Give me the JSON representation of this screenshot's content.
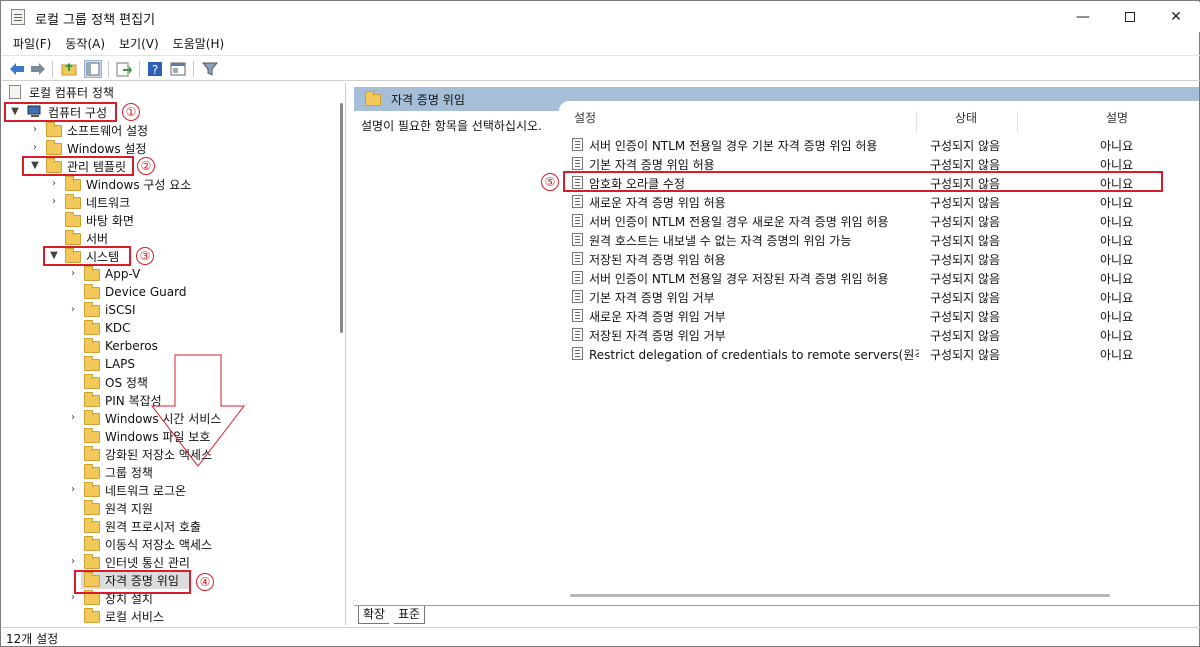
{
  "window": {
    "title": "로컬 그룹 정책 편집기",
    "minimize_icon": "minimize-icon",
    "maximize_icon": "maximize-icon",
    "close_icon": "close-icon"
  },
  "menu": [
    "파일(F)",
    "동작(A)",
    "보기(V)",
    "도움말(H)"
  ],
  "toolbar": [
    "back-arrow-icon",
    "forward-arrow-icon",
    "up-folder-icon",
    "show-hide-tree-icon",
    "export-list-icon",
    "help-icon",
    "properties-icon",
    "filter-icon"
  ],
  "tree": {
    "root": "로컬 컴퓨터 정책",
    "computer_config": "컴퓨터 구성",
    "software_settings": "소프트웨어 설정",
    "windows_settings": "Windows 설정",
    "admin_templates": "관리 템플릿",
    "admin_children": [
      "Windows 구성 요소",
      "네트워크",
      "바탕 화면",
      "서버"
    ],
    "system": "시스템",
    "system_children": [
      "App-V",
      "Device Guard",
      "iSCSI",
      "KDC",
      "Kerberos",
      "LAPS",
      "OS 정책",
      "PIN 복잡성",
      "Windows 시간 서비스",
      "Windows 파일 보호",
      "강화된 저장소 액세스",
      "그룹 정책",
      "네트워크 로그온",
      "원격 지원",
      "원격 프로시저 호출",
      "이동식 저장소 액세스",
      "인터넷 통신 관리",
      "자격 증명 위임",
      "장치 설치",
      "로컬 서비스"
    ]
  },
  "annotations": [
    "①",
    "②",
    "③",
    "④",
    "⑤"
  ],
  "right": {
    "header": "자격 증명 위임",
    "description": "설명이 필요한 항목을 선택하십시오.",
    "columns": [
      "설정",
      "상태",
      "설명"
    ],
    "rows": [
      {
        "setting": "서버 인증이 NTLM 전용일 경우 기본 자격 증명 위임 허용",
        "state": "구성되지 않음",
        "comment": "아니요"
      },
      {
        "setting": "기본 자격 증명 위임 허용",
        "state": "구성되지 않음",
        "comment": "아니요"
      },
      {
        "setting": "암호화 오라클 수정",
        "state": "구성되지 않음",
        "comment": "아니요"
      },
      {
        "setting": "새로운 자격 증명 위임 허용",
        "state": "구성되지 않음",
        "comment": "아니요"
      },
      {
        "setting": "서버 인증이 NTLM 전용일 경우 새로운 자격 증명 위임 허용",
        "state": "구성되지 않음",
        "comment": "아니요"
      },
      {
        "setting": "원격 호스트는 내보낼 수 없는 자격 증명의 위임 가능",
        "state": "구성되지 않음",
        "comment": "아니요"
      },
      {
        "setting": "저장된 자격 증명 위임 허용",
        "state": "구성되지 않음",
        "comment": "아니요"
      },
      {
        "setting": "서버 인증이 NTLM 전용일 경우 저장된 자격 증명 위임 허용",
        "state": "구성되지 않음",
        "comment": "아니요"
      },
      {
        "setting": "기본 자격 증명 위임 거부",
        "state": "구성되지 않음",
        "comment": "아니요"
      },
      {
        "setting": "새로운 자격 증명 위임 거부",
        "state": "구성되지 않음",
        "comment": "아니요"
      },
      {
        "setting": "저장된 자격 증명 위임 거부",
        "state": "구성되지 않음",
        "comment": "아니요"
      },
      {
        "setting": "Restrict delegation of credentials to remote servers(원격 서...",
        "state": "구성되지 않음",
        "comment": "아니요"
      }
    ]
  },
  "tabs": [
    "확장",
    "표준"
  ],
  "status": "12개 설정",
  "colors": {
    "accent_red": "#d81e2a",
    "header_blue": "#a7bed8",
    "folder_yellow": "#f2c85b"
  }
}
